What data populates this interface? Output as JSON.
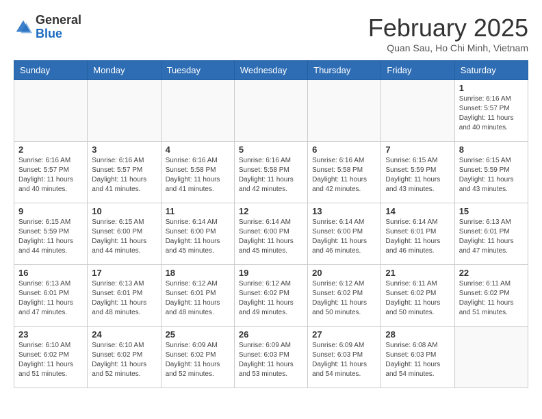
{
  "header": {
    "logo_line1": "General",
    "logo_line2": "Blue",
    "month": "February 2025",
    "location": "Quan Sau, Ho Chi Minh, Vietnam"
  },
  "weekdays": [
    "Sunday",
    "Monday",
    "Tuesday",
    "Wednesday",
    "Thursday",
    "Friday",
    "Saturday"
  ],
  "weeks": [
    [
      {
        "day": "",
        "info": ""
      },
      {
        "day": "",
        "info": ""
      },
      {
        "day": "",
        "info": ""
      },
      {
        "day": "",
        "info": ""
      },
      {
        "day": "",
        "info": ""
      },
      {
        "day": "",
        "info": ""
      },
      {
        "day": "1",
        "info": "Sunrise: 6:16 AM\nSunset: 5:57 PM\nDaylight: 11 hours and 40 minutes."
      }
    ],
    [
      {
        "day": "2",
        "info": "Sunrise: 6:16 AM\nSunset: 5:57 PM\nDaylight: 11 hours and 40 minutes."
      },
      {
        "day": "3",
        "info": "Sunrise: 6:16 AM\nSunset: 5:57 PM\nDaylight: 11 hours and 41 minutes."
      },
      {
        "day": "4",
        "info": "Sunrise: 6:16 AM\nSunset: 5:58 PM\nDaylight: 11 hours and 41 minutes."
      },
      {
        "day": "5",
        "info": "Sunrise: 6:16 AM\nSunset: 5:58 PM\nDaylight: 11 hours and 42 minutes."
      },
      {
        "day": "6",
        "info": "Sunrise: 6:16 AM\nSunset: 5:58 PM\nDaylight: 11 hours and 42 minutes."
      },
      {
        "day": "7",
        "info": "Sunrise: 6:15 AM\nSunset: 5:59 PM\nDaylight: 11 hours and 43 minutes."
      },
      {
        "day": "8",
        "info": "Sunrise: 6:15 AM\nSunset: 5:59 PM\nDaylight: 11 hours and 43 minutes."
      }
    ],
    [
      {
        "day": "9",
        "info": "Sunrise: 6:15 AM\nSunset: 5:59 PM\nDaylight: 11 hours and 44 minutes."
      },
      {
        "day": "10",
        "info": "Sunrise: 6:15 AM\nSunset: 6:00 PM\nDaylight: 11 hours and 44 minutes."
      },
      {
        "day": "11",
        "info": "Sunrise: 6:14 AM\nSunset: 6:00 PM\nDaylight: 11 hours and 45 minutes."
      },
      {
        "day": "12",
        "info": "Sunrise: 6:14 AM\nSunset: 6:00 PM\nDaylight: 11 hours and 45 minutes."
      },
      {
        "day": "13",
        "info": "Sunrise: 6:14 AM\nSunset: 6:00 PM\nDaylight: 11 hours and 46 minutes."
      },
      {
        "day": "14",
        "info": "Sunrise: 6:14 AM\nSunset: 6:01 PM\nDaylight: 11 hours and 46 minutes."
      },
      {
        "day": "15",
        "info": "Sunrise: 6:13 AM\nSunset: 6:01 PM\nDaylight: 11 hours and 47 minutes."
      }
    ],
    [
      {
        "day": "16",
        "info": "Sunrise: 6:13 AM\nSunset: 6:01 PM\nDaylight: 11 hours and 47 minutes."
      },
      {
        "day": "17",
        "info": "Sunrise: 6:13 AM\nSunset: 6:01 PM\nDaylight: 11 hours and 48 minutes."
      },
      {
        "day": "18",
        "info": "Sunrise: 6:12 AM\nSunset: 6:01 PM\nDaylight: 11 hours and 48 minutes."
      },
      {
        "day": "19",
        "info": "Sunrise: 6:12 AM\nSunset: 6:02 PM\nDaylight: 11 hours and 49 minutes."
      },
      {
        "day": "20",
        "info": "Sunrise: 6:12 AM\nSunset: 6:02 PM\nDaylight: 11 hours and 50 minutes."
      },
      {
        "day": "21",
        "info": "Sunrise: 6:11 AM\nSunset: 6:02 PM\nDaylight: 11 hours and 50 minutes."
      },
      {
        "day": "22",
        "info": "Sunrise: 6:11 AM\nSunset: 6:02 PM\nDaylight: 11 hours and 51 minutes."
      }
    ],
    [
      {
        "day": "23",
        "info": "Sunrise: 6:10 AM\nSunset: 6:02 PM\nDaylight: 11 hours and 51 minutes."
      },
      {
        "day": "24",
        "info": "Sunrise: 6:10 AM\nSunset: 6:02 PM\nDaylight: 11 hours and 52 minutes."
      },
      {
        "day": "25",
        "info": "Sunrise: 6:09 AM\nSunset: 6:02 PM\nDaylight: 11 hours and 52 minutes."
      },
      {
        "day": "26",
        "info": "Sunrise: 6:09 AM\nSunset: 6:03 PM\nDaylight: 11 hours and 53 minutes."
      },
      {
        "day": "27",
        "info": "Sunrise: 6:09 AM\nSunset: 6:03 PM\nDaylight: 11 hours and 54 minutes."
      },
      {
        "day": "28",
        "info": "Sunrise: 6:08 AM\nSunset: 6:03 PM\nDaylight: 11 hours and 54 minutes."
      },
      {
        "day": "",
        "info": ""
      }
    ]
  ]
}
